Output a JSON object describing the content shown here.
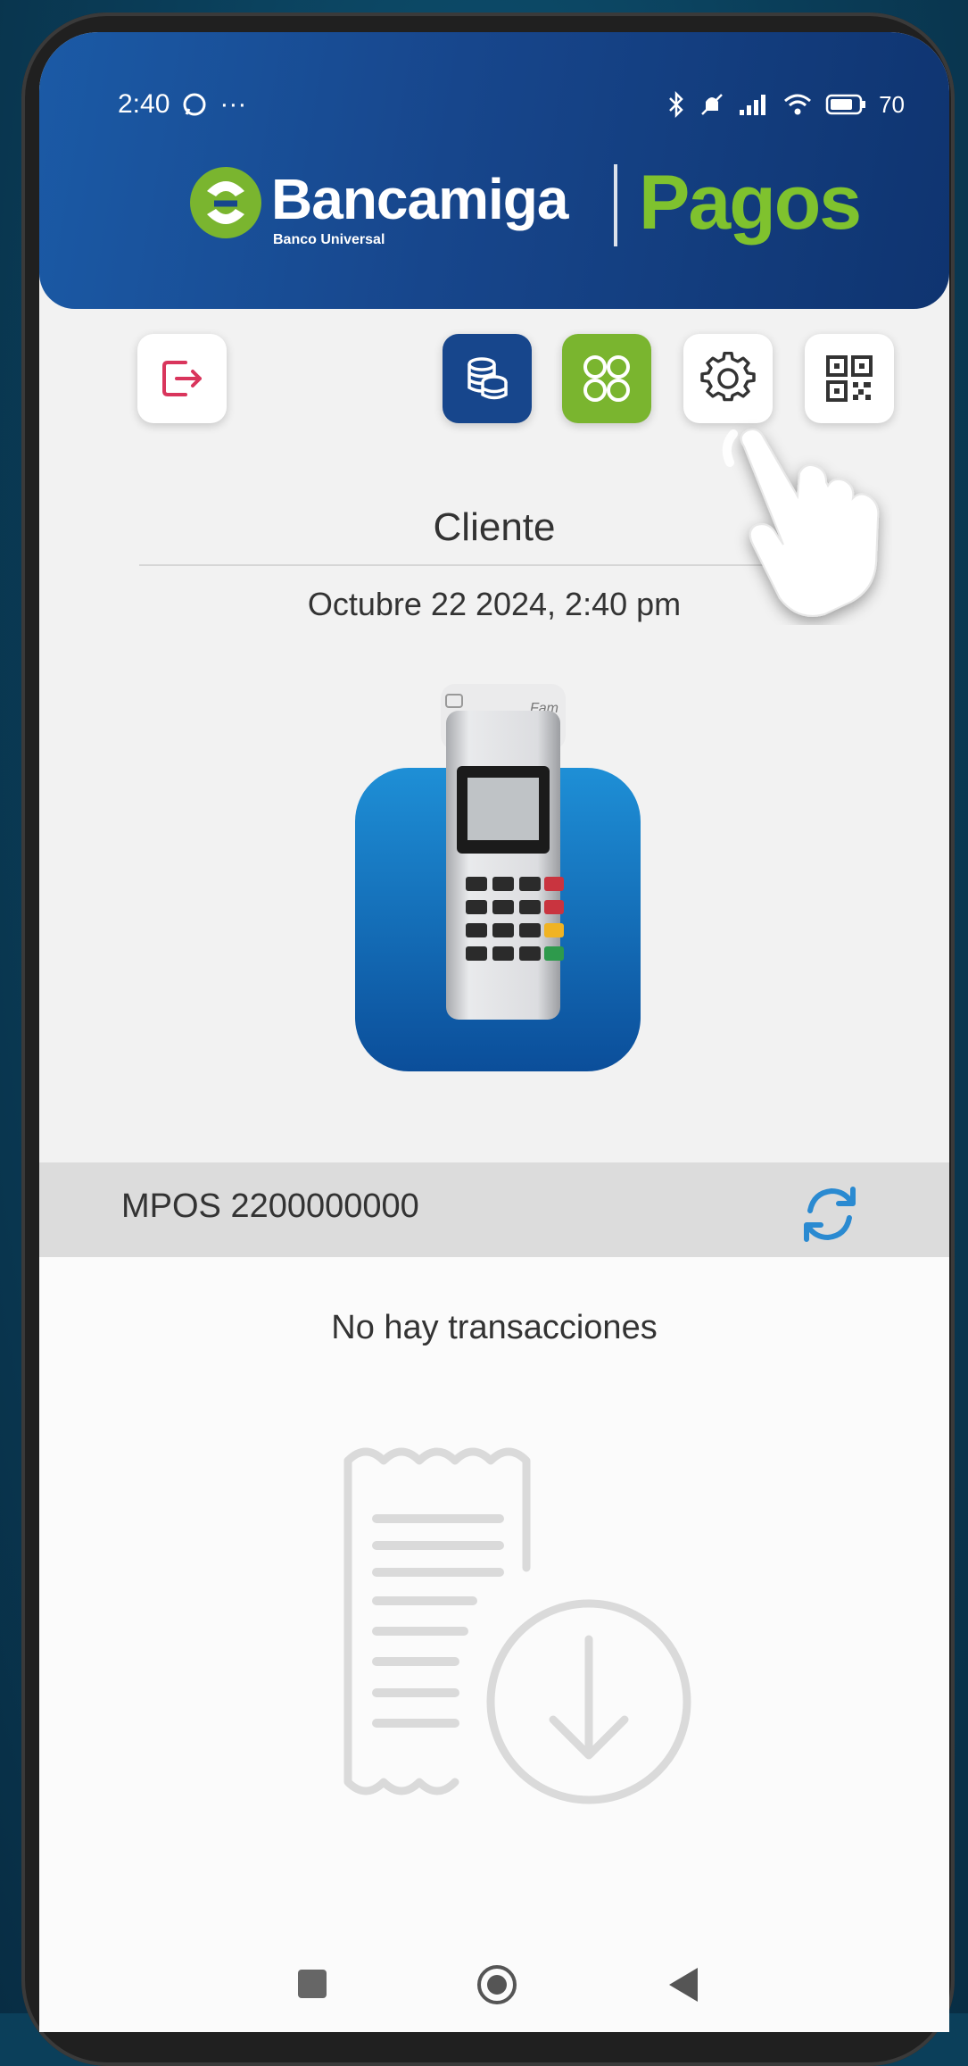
{
  "status_bar": {
    "time": "2:40",
    "battery": "70"
  },
  "brand": {
    "bank_name": "Bancamiga",
    "bank_subtitle": "Banco Universal",
    "product": "Pagos",
    "green": "#7ab52f",
    "blue": "#17468c"
  },
  "toolbar": {
    "icons": [
      "logout-icon",
      "coins-icon",
      "apps-grid-icon",
      "gear-icon",
      "qr-code-icon"
    ]
  },
  "client": {
    "label": "Cliente",
    "datetime": "Octubre 22 2024, 2:40 pm"
  },
  "device": {
    "brand_label": "Fam"
  },
  "terminal": {
    "label": "MPOS 2200000000"
  },
  "transactions": {
    "empty_message": "No hay transacciones"
  },
  "nav": {
    "icons": [
      "recents-icon",
      "home-icon",
      "back-icon"
    ]
  }
}
